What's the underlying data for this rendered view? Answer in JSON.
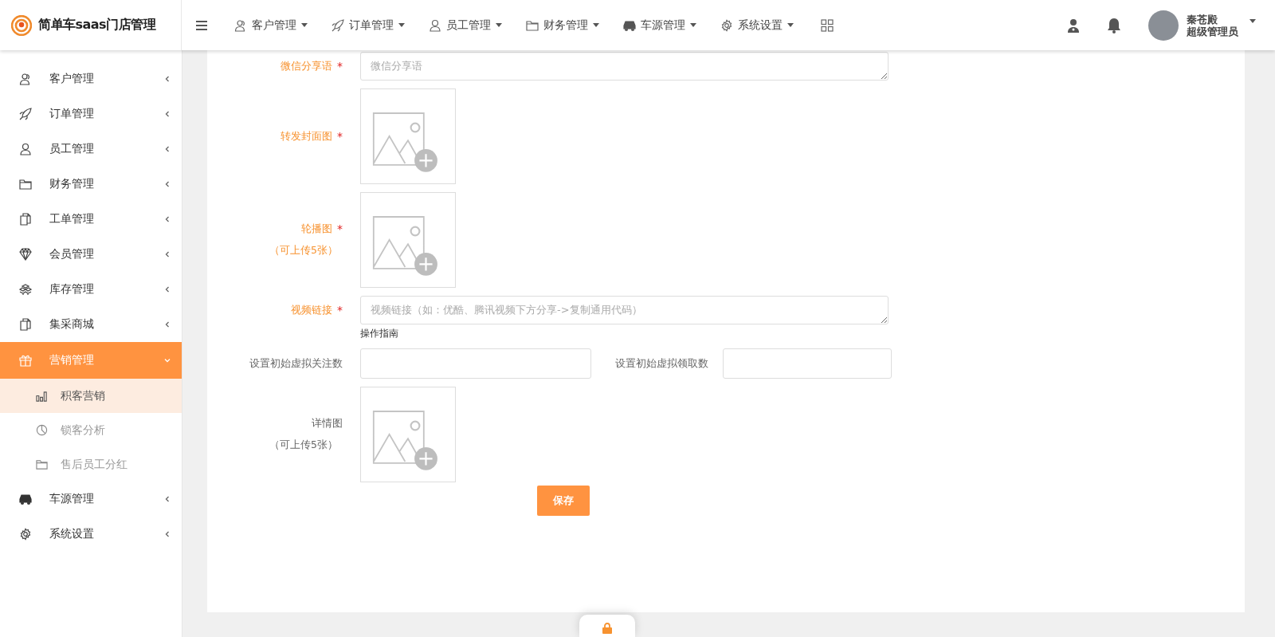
{
  "brand": {
    "title": "简单车saas门店管理"
  },
  "topnav": [
    {
      "label": "客户管理"
    },
    {
      "label": "订单管理"
    },
    {
      "label": "员工管理"
    },
    {
      "label": "财务管理"
    },
    {
      "label": "车源管理"
    },
    {
      "label": "系统设置"
    }
  ],
  "user": {
    "name": "秦苍殿",
    "role": "超级管理员"
  },
  "sidebar": {
    "items": [
      {
        "label": "客户管理",
        "expanded": false
      },
      {
        "label": "订单管理",
        "expanded": false
      },
      {
        "label": "员工管理",
        "expanded": false
      },
      {
        "label": "财务管理",
        "expanded": false
      },
      {
        "label": "工单管理",
        "expanded": false
      },
      {
        "label": "会员管理",
        "expanded": false
      },
      {
        "label": "库存管理",
        "expanded": false
      },
      {
        "label": "集采商城",
        "expanded": false
      },
      {
        "label": "营销管理",
        "expanded": true,
        "children": [
          {
            "label": "积客营销",
            "selected": true
          },
          {
            "label": "锁客分析",
            "selected": false
          },
          {
            "label": "售后员工分红",
            "selected": false
          }
        ]
      },
      {
        "label": "车源管理",
        "expanded": false
      },
      {
        "label": "系统设置",
        "expanded": false
      }
    ]
  },
  "form": {
    "rows": [
      {
        "kind": "textarea",
        "label": "微信分享语",
        "required": true,
        "mark": "*",
        "placeholder": "微信分享语"
      },
      {
        "kind": "upload",
        "label": "转发封面图",
        "required": true,
        "mark": "*"
      },
      {
        "kind": "upload",
        "label": "轮播图",
        "note": "（可上传5张）",
        "required": true,
        "mark": "*"
      },
      {
        "kind": "textarea",
        "label": "视频链接",
        "required": true,
        "mark": "*",
        "placeholder": "视频链接（如：优酷、腾讯视频下方分享->复制通用代码）",
        "link": "操作指南"
      },
      {
        "kind": "pair",
        "label": "设置初始虚拟关注数",
        "required": false,
        "label2": "设置初始虚拟领取数"
      },
      {
        "kind": "upload",
        "label": "详情图",
        "note": "（可上传5张）",
        "required": false
      }
    ],
    "save": "保存"
  }
}
